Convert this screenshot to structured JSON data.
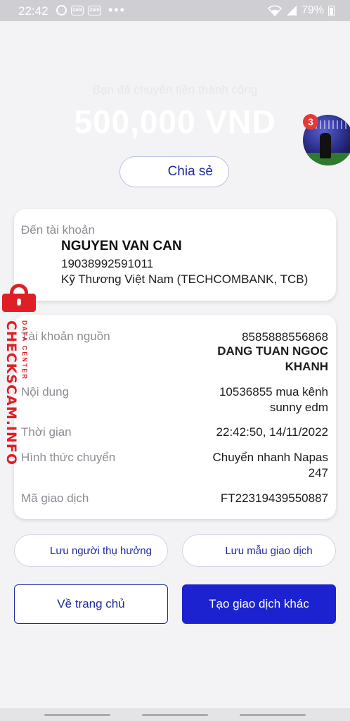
{
  "status_bar": {
    "time": "22:42",
    "app1": "Zalo",
    "app2": "Zalo",
    "more": "•••",
    "battery": "79%"
  },
  "header": {
    "success_message": "Bạn đã chuyển tiền thành công",
    "amount": "500,000 VND",
    "share_label": "Chia sẻ"
  },
  "notification_badge": "3",
  "recipient": {
    "label": "Đến tài khoản",
    "name": "NGUYEN VAN CAN",
    "account_number": "19038992591011",
    "bank": "Kỹ Thương Việt Nam (TECHCOMBANK, TCB)"
  },
  "details": {
    "source_label": "Tài khoản nguồn",
    "source_account": "8585888556868",
    "source_name_line1": "DANG TUAN NGOC",
    "source_name_line2": "KHANH",
    "content_label": "Nội dung",
    "content_line1": "10536855 mua kênh",
    "content_line2": "sunny edm",
    "time_label": "Thời gian",
    "time_value": "22:42:50, 14/11/2022",
    "method_label": "Hình thức chuyển",
    "method_line1": "Chuyển nhanh Napas",
    "method_line2": "247",
    "txn_label": "Mã giao dịch",
    "txn_value": "FT22319439550887"
  },
  "actions": {
    "save_beneficiary": "Lưu người thụ hưởng",
    "save_template": "Lưu mẫu giao dịch",
    "home": "Về trang chủ",
    "new_transaction": "Tạo giao dịch khác"
  },
  "watermark": {
    "main": "CHECKSCAM.INFO",
    "sub": "DATA CENTER"
  },
  "colors": {
    "primary": "#1c22cf",
    "watermark": "#e01e25"
  }
}
